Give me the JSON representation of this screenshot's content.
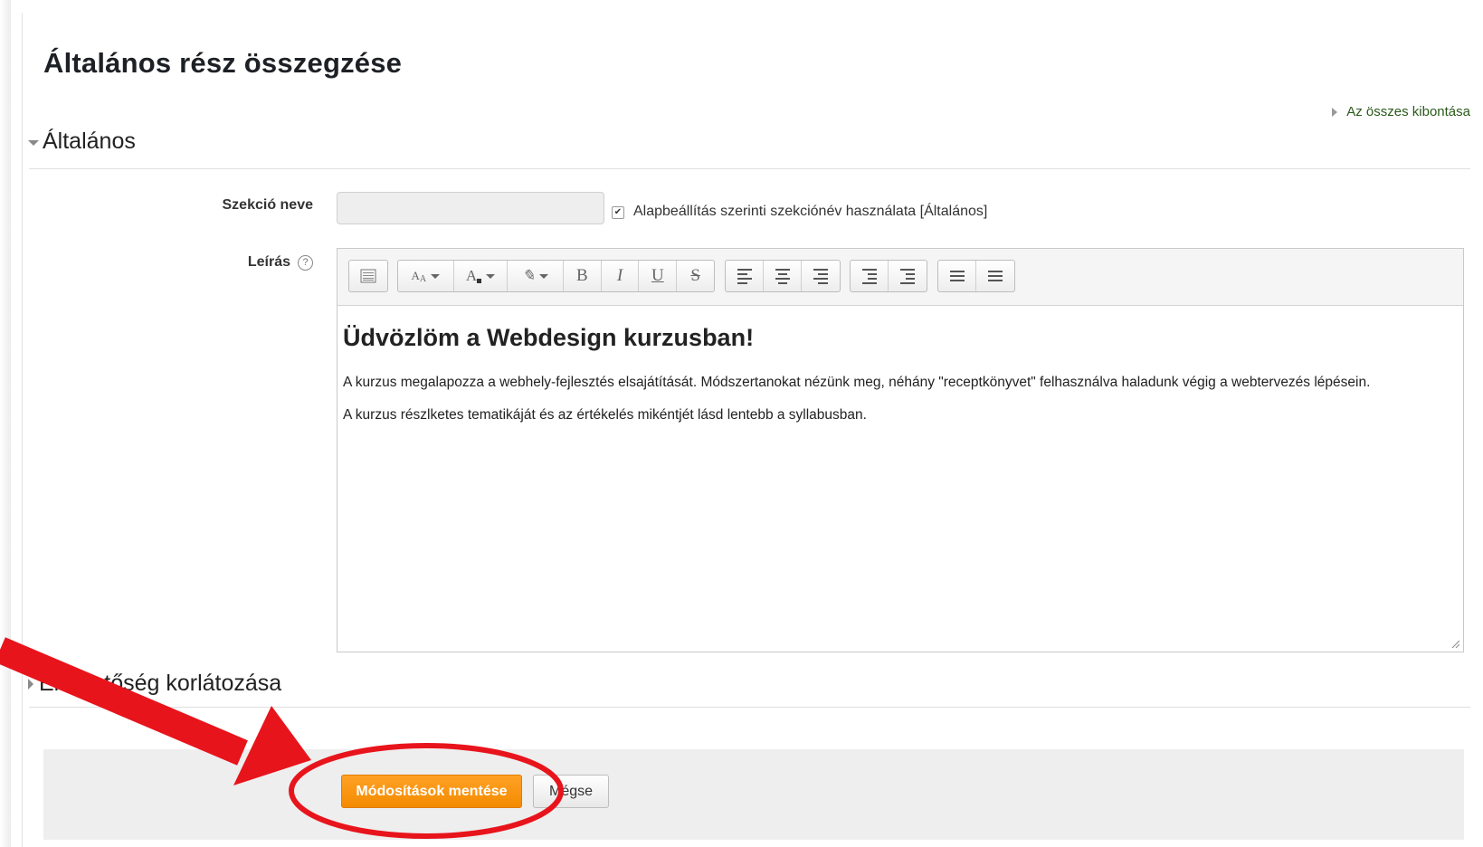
{
  "page": {
    "title": "Általános rész összegzése",
    "expand_all": "Az összes kibontása"
  },
  "sections": {
    "general": {
      "label": "Általános",
      "expanded": true
    },
    "restrictions": {
      "label": "Elérhetőség korlátozása",
      "expanded": false
    }
  },
  "form": {
    "section_name_label": "Szekció neve",
    "section_name_value": "",
    "default_name_checkbox_label": "Alapbeállítás szerinti szekciónév használata [Általános]",
    "default_name_checked": true,
    "description_label": "Leírás",
    "help_icon": "?"
  },
  "editor": {
    "toolbar_groups": [
      [
        "toggle-toolbar"
      ],
      [
        "font-size",
        "font-color",
        "highlight",
        "bold",
        "italic",
        "underline",
        "strikethrough"
      ],
      [
        "align-left",
        "align-center",
        "align-right"
      ],
      [
        "outdent",
        "indent"
      ],
      [
        "unordered-list",
        "ordered-list"
      ]
    ],
    "heading": "Üdvözlöm a Webdesign kurzusban!",
    "paragraph1": "A kurzus megalapozza a webhely-fejlesztés elsajátítását. Módszertanokat nézünk meg, néhány \"receptkönyvet\" felhasználva haladunk végig a webtervezés lépésein.",
    "paragraph2": "A kurzus részlketes tematikáját és az értékelés mikéntjét lásd lentebb a syllabusban."
  },
  "buttons": {
    "save": "Módosítások mentése",
    "cancel": "Mégse"
  },
  "annotation": {
    "arrow_color": "#e8141c",
    "circle_color": "#e8141c"
  },
  "colors": {
    "save_button": "#f7931e",
    "link": "#2a5a1b",
    "footer_bg": "#eeeeee"
  }
}
